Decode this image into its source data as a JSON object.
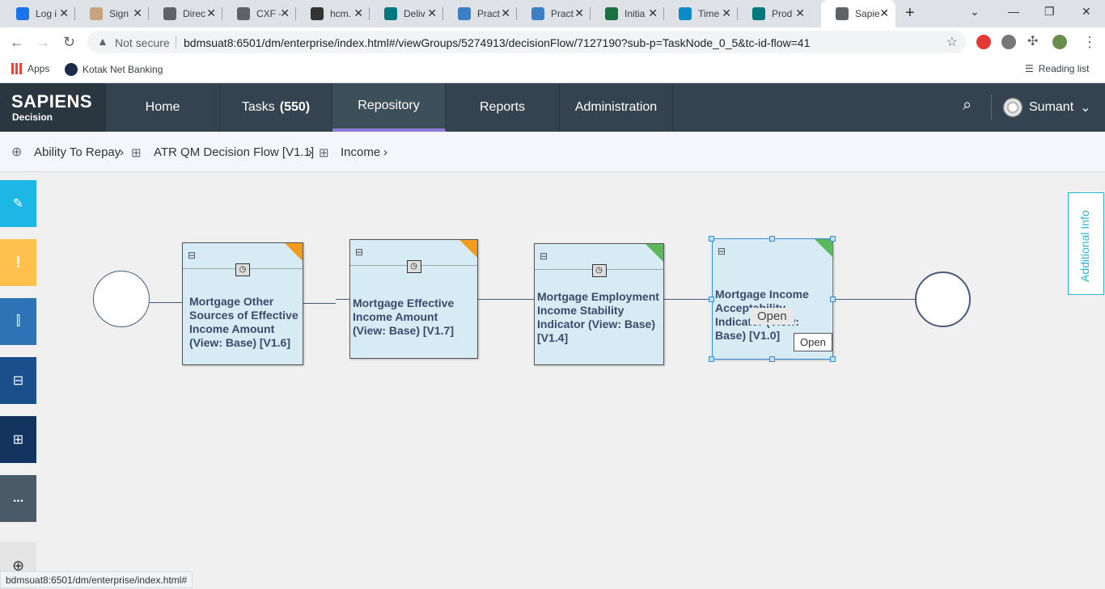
{
  "browser": {
    "tabs": [
      {
        "title": "Log i",
        "color": "#1a73e8"
      },
      {
        "title": "Sign",
        "color": "#c9a27e"
      },
      {
        "title": "Direc",
        "color": "#5f6368"
      },
      {
        "title": "CXF -",
        "color": "#5f6368"
      },
      {
        "title": "hcm.",
        "color": "#333333"
      },
      {
        "title": "Deliv",
        "color": "#03787c"
      },
      {
        "title": "Pract",
        "color": "#3b7fc4"
      },
      {
        "title": "Pract",
        "color": "#3b7fc4"
      },
      {
        "title": "Initia",
        "color": "#1d6f42"
      },
      {
        "title": "Time",
        "color": "#0c8ac6"
      },
      {
        "title": "Prod",
        "color": "#03787c"
      },
      {
        "title": "Sapie",
        "color": "#5f6368"
      }
    ],
    "not_secure": "Not secure",
    "url": "bdmsuat8:6501/dm/enterprise/index.html#/viewGroups/5274913/decisionFlow/7127190?sub-p=TaskNode_0_5&tc-id-flow=41",
    "bookmarks": {
      "apps": "Apps",
      "kotak": "Kotak Net Banking",
      "reading": "Reading list"
    },
    "status_url": "bdmsuat8:6501/dm/enterprise/index.html#"
  },
  "app": {
    "logo_main": "SAPIENS",
    "logo_sub": "Decision",
    "nav": {
      "home": "Home",
      "tasks": "Tasks",
      "tasks_count": "(550)",
      "repository": "Repository",
      "reports": "Reports",
      "administration": "Administration"
    },
    "user": "Sumant",
    "colors": {
      "accent": "#8c7bd8",
      "header": "#34434f",
      "warning": "#f29b1d",
      "ok": "#5cb85c"
    }
  },
  "breadcrumb": {
    "root": "Ability To Repay",
    "flow": "ATR QM Decision Flow [V1.1]",
    "current": "Income"
  },
  "sidebar": {
    "icons": [
      "pencil-icon",
      "exclamation-icon",
      "test-tube-icon",
      "tree-icon",
      "flow-icon",
      "more-icon",
      "zoom-icon"
    ],
    "exclamation": "!",
    "more": "..."
  },
  "flow": {
    "nodes": [
      {
        "label": "Mortgage Other Sources of Effective Income Amount (View: Base) [V1.6]",
        "status": "warning"
      },
      {
        "label": "Mortgage Effective Income Amount (View: Base) [V1.7]",
        "status": "warning"
      },
      {
        "label": "Mortgage Employment Income Stability Indicator (View: Base) [V1.4]",
        "status": "ok"
      },
      {
        "label": "Mortgage Income Acceptability Indicator (View: Base) [V1.0]",
        "status": "ok"
      }
    ],
    "context_menu": "Open",
    "tooltip": "Open"
  },
  "additional_info": "Additional Info"
}
